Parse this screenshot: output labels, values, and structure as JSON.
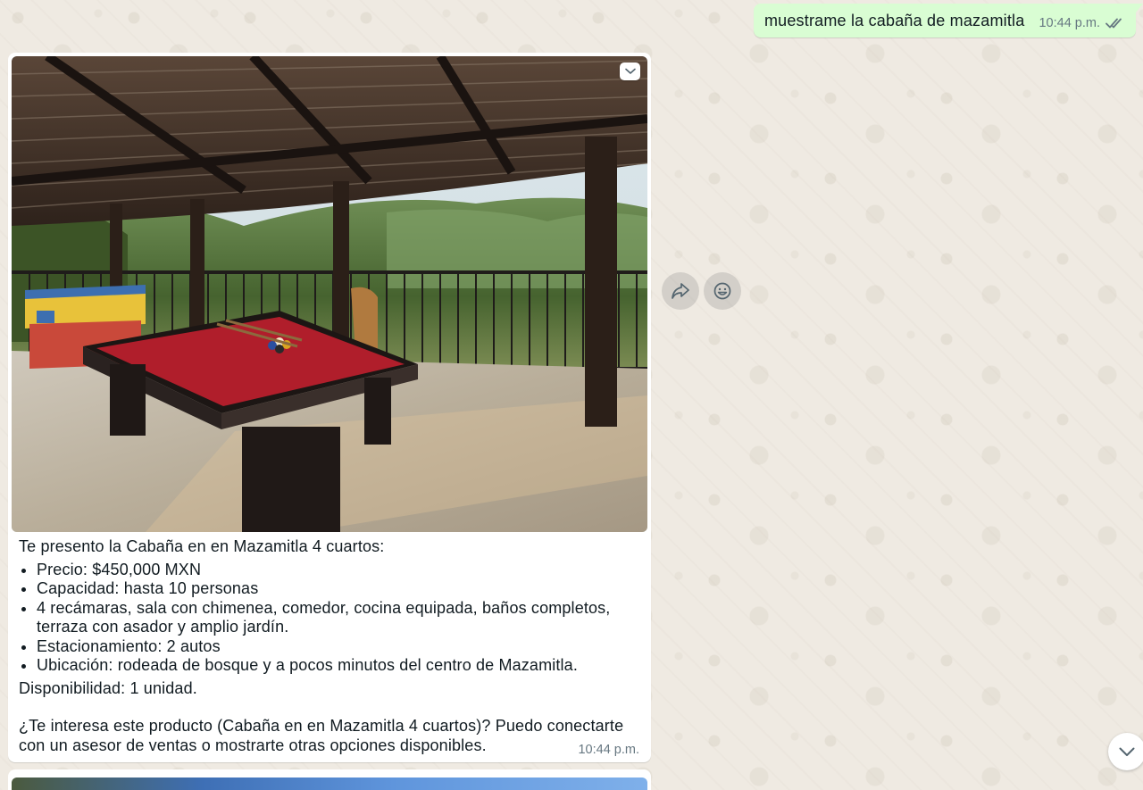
{
  "outgoing": {
    "text": "muestrame la cabaña de mazamitla",
    "time": "10:44 p.m.",
    "status_icon": "double-check-icon"
  },
  "incoming": {
    "image_icon": "photo-pool-table-terrace",
    "menu_icon": "chevron-down-icon",
    "intro": "Te presento la Cabaña en en Mazamitla 4 cuartos:",
    "bullets": [
      "Precio: $450,000 MXN",
      "Capacidad: hasta 10 personas",
      "4 recámaras, sala con chimenea, comedor, cocina equipada, baños completos, terraza con asador y amplio jardín.",
      "Estacionamiento: 2 autos",
      "Ubicación: rodeada de bosque y a pocos minutos del centro de Mazamitla."
    ],
    "availability": "Disponibilidad: 1 unidad.",
    "question": "¿Te interesa este producto (Cabaña en en Mazamitla 4 cuartos)? Puedo conectarte con un asesor de ventas o mostrarte otras opciones disponibles.",
    "time": "10:44 p.m."
  },
  "actions": {
    "forward_icon": "forward-icon",
    "react_icon": "emoji-icon",
    "scroll_icon": "chevron-down-icon"
  },
  "colors": {
    "chat_background": "#efeae2",
    "outgoing_bubble": "#d9fdd3",
    "incoming_bubble": "#ffffff",
    "meta_text": "#667781",
    "tick_color": "#667781"
  }
}
